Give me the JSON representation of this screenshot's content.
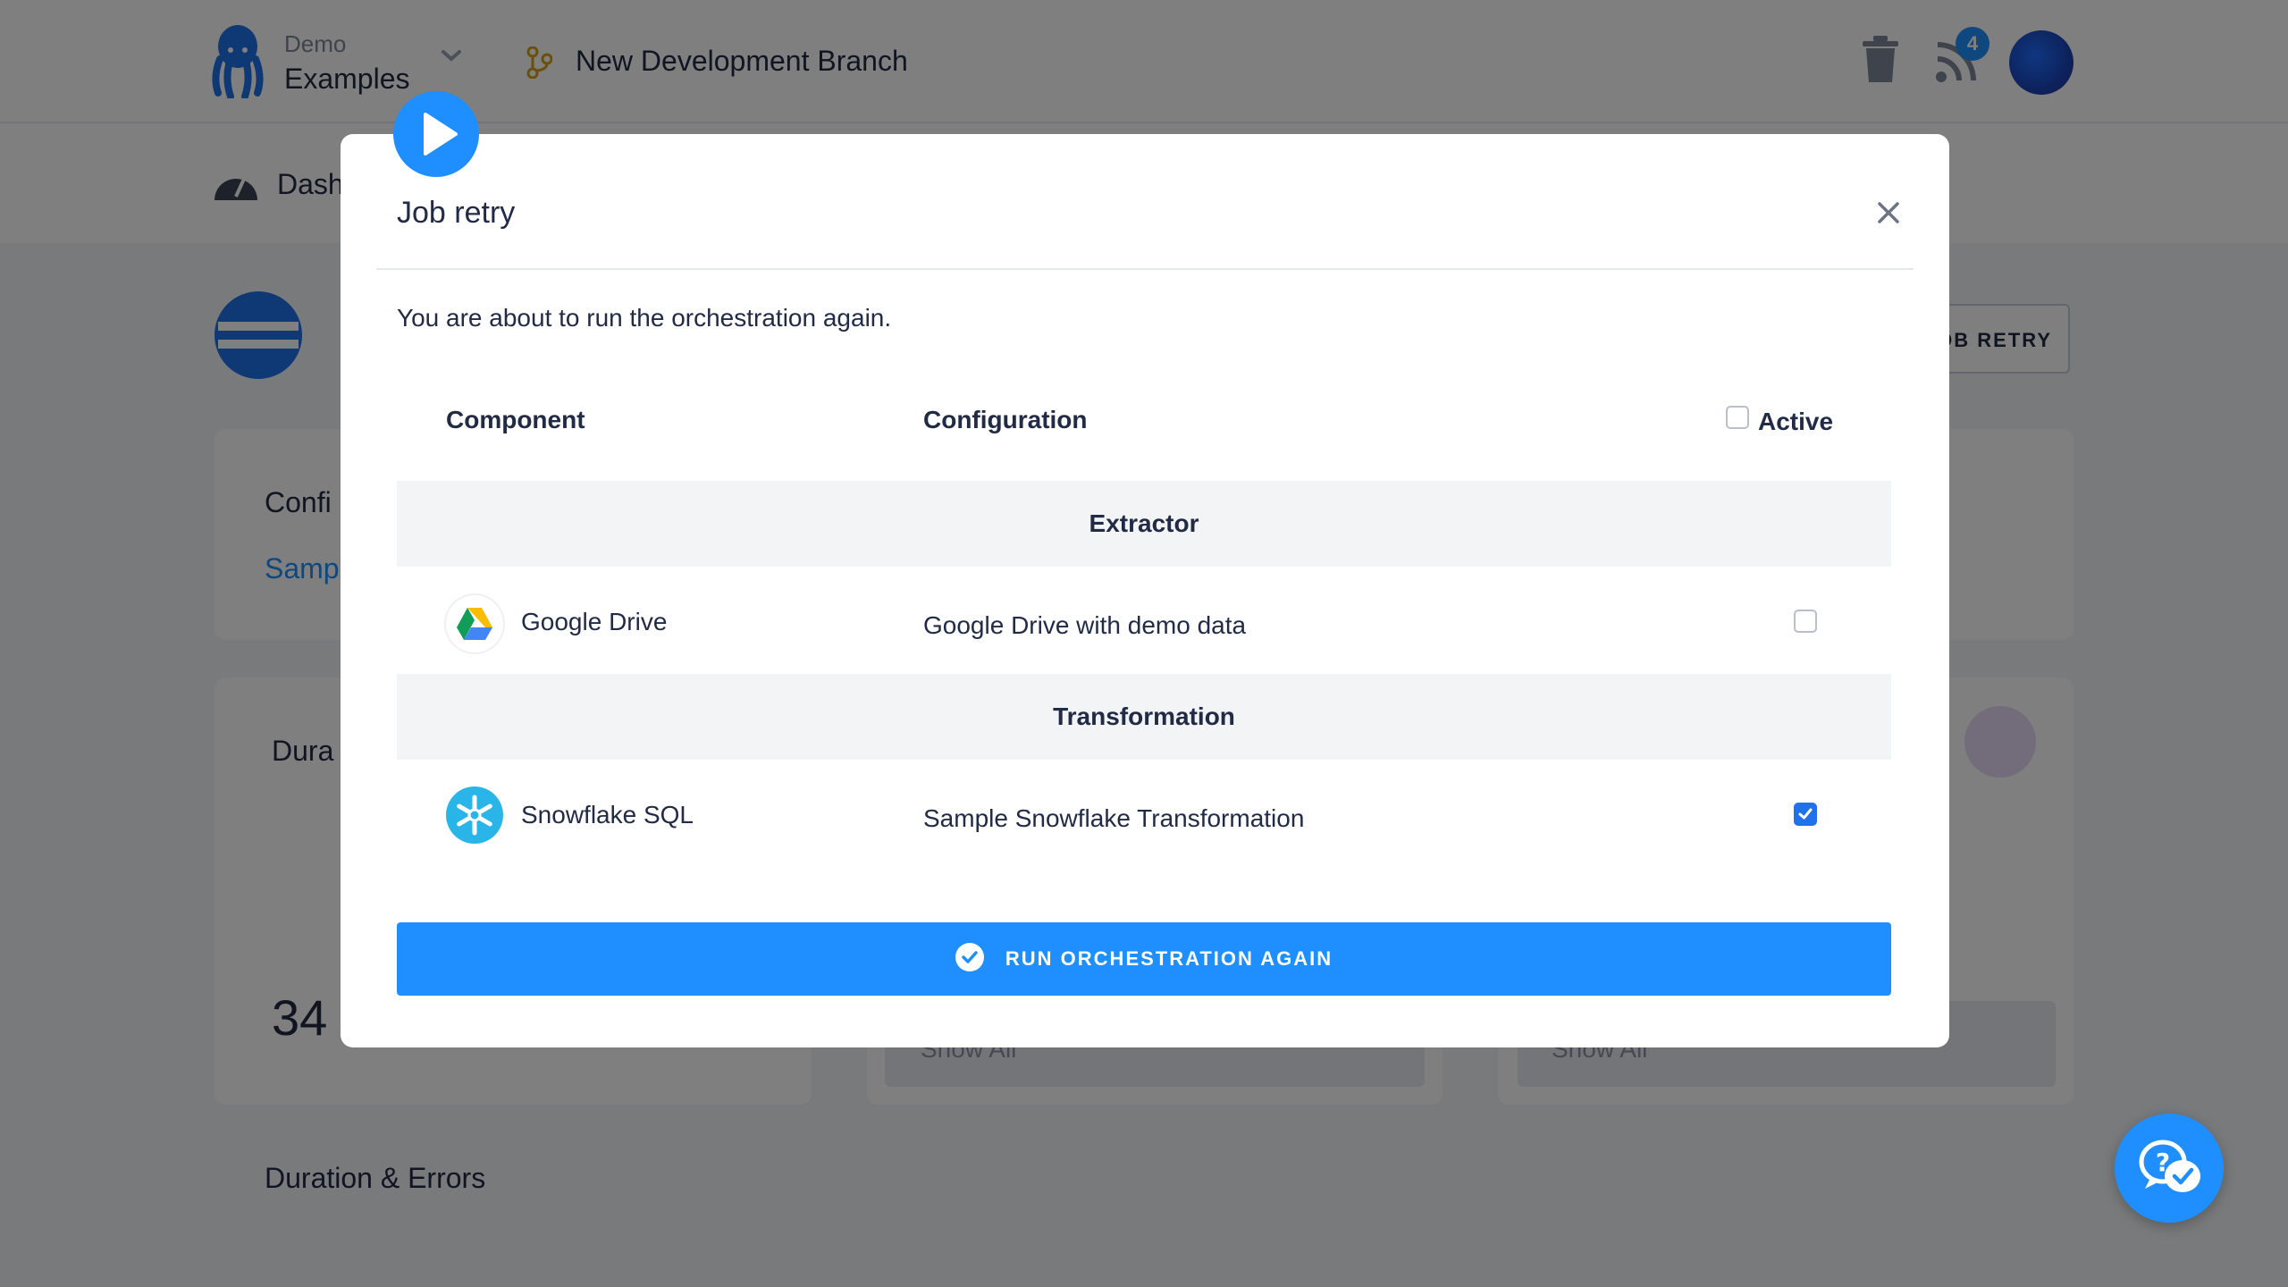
{
  "header": {
    "project_label": "Demo",
    "project_name": "Examples",
    "branch_name": "New Development Branch",
    "notification_count": "4"
  },
  "subnav": {
    "dashboard_label": "Dash"
  },
  "background": {
    "job_retry_label": "OB RETRY",
    "config_heading": "Confi",
    "config_link": "Samp",
    "duration_heading": "Dura",
    "duration_value": "34",
    "show_all_1": "Show All",
    "show_all_2": "Show All",
    "duration_errors_heading": "Duration & Errors"
  },
  "modal": {
    "title": "Job retry",
    "description": "You are about to run the orchestration again.",
    "columns": {
      "component": "Component",
      "configuration": "Configuration",
      "active": "Active"
    },
    "groups": [
      {
        "label": "Extractor",
        "rows": [
          {
            "component": "Google Drive",
            "configuration": "Google Drive with demo data",
            "active": false
          }
        ]
      },
      {
        "label": "Transformation",
        "rows": [
          {
            "component": "Snowflake SQL",
            "configuration": "Sample Snowflake Transformation",
            "active": true
          }
        ]
      }
    ],
    "run_button": "RUN ORCHESTRATION AGAIN"
  },
  "colors": {
    "primary": "#1f8fff",
    "checkbox_checked": "#1f72e8",
    "overlay": "rgba(0,0,0,0.5)"
  },
  "icons": [
    "octopus-logo-icon",
    "chevron-down-icon",
    "branch-icon",
    "trash-icon",
    "rss-icon",
    "dashboard-icon",
    "play-icon",
    "close-icon",
    "google-drive-icon",
    "snowflake-icon",
    "check-circle-icon",
    "help-chat-icon"
  ]
}
